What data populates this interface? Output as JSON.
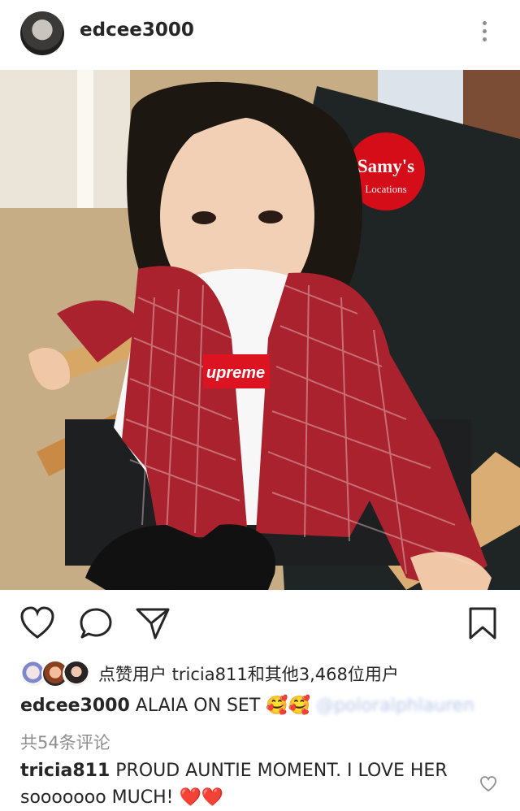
{
  "post": {
    "username": "edcee3000",
    "photo_sign_text": "Samy's",
    "photo_sign_subtext": "Locations",
    "shirt_text": "upreme"
  },
  "likes": {
    "text": "点赞用户 tricia811和其他3,468位用户"
  },
  "caption": {
    "username": "edcee3000",
    "text": "ALAIA ON SET",
    "emojis": "🥰🥰",
    "mention": "@poloralphlauren"
  },
  "comments": {
    "view_all": "共54条评论",
    "items": [
      {
        "username": "tricia811",
        "text": "PROUD AUNTIE MOMENT. I LOVE HER sooooooo MUCH!",
        "emojis": "❤️❤️"
      }
    ]
  },
  "icons": [
    "more-icon",
    "like-icon",
    "comment-icon",
    "share-icon",
    "save-icon",
    "comment-like-icon"
  ]
}
